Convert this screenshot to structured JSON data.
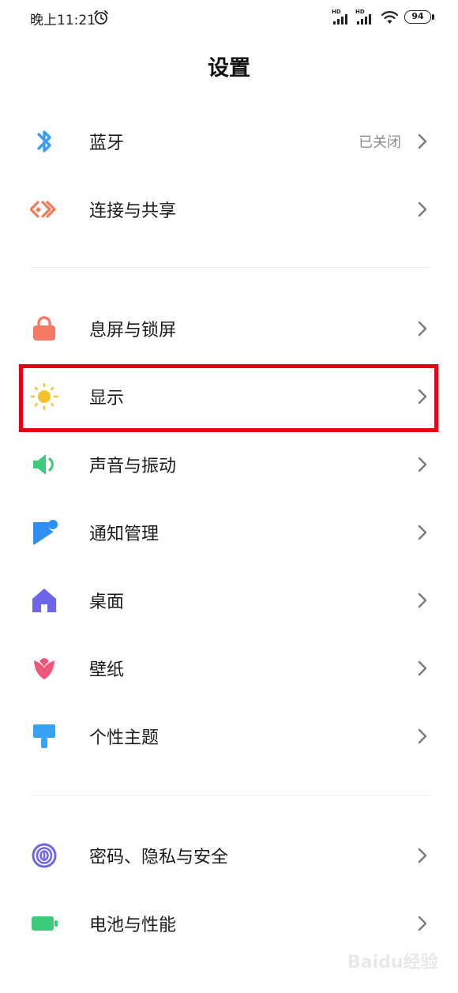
{
  "status_bar": {
    "time": "晚上11:21",
    "battery": "94",
    "signal_label_1": "HD",
    "signal_label_2": "HD"
  },
  "page": {
    "title": "设置"
  },
  "sections": [
    {
      "items": [
        {
          "label": "蓝牙",
          "value": "已关闭",
          "icon": "bluetooth-icon",
          "color": "#3b9cf2"
        },
        {
          "label": "连接与共享",
          "value": "",
          "icon": "connection-share-icon",
          "color": "#f07a5a"
        }
      ]
    },
    {
      "items": [
        {
          "label": "息屏与锁屏",
          "value": "",
          "icon": "lock-icon",
          "color": "#f47a66"
        },
        {
          "label": "显示",
          "value": "",
          "icon": "sun-icon",
          "color": "#f6c02a"
        },
        {
          "label": "声音与振动",
          "value": "",
          "icon": "speaker-icon",
          "color": "#3ccb7a"
        },
        {
          "label": "通知管理",
          "value": "",
          "icon": "notification-icon",
          "color": "#2f8ef0"
        },
        {
          "label": "桌面",
          "value": "",
          "icon": "home-icon",
          "color": "#6e66e8"
        },
        {
          "label": "壁纸",
          "value": "",
          "icon": "tulip-icon",
          "color": "#f0557c"
        },
        {
          "label": "个性主题",
          "value": "",
          "icon": "brush-icon",
          "color": "#3aa2f2"
        }
      ]
    },
    {
      "items": [
        {
          "label": "密码、隐私与安全",
          "value": "",
          "icon": "fingerprint-icon",
          "color": "#6e66e8"
        },
        {
          "label": "电池与性能",
          "value": "",
          "icon": "battery-icon",
          "color": "#3ccb7a"
        }
      ]
    }
  ],
  "highlight": {
    "target": "显示",
    "color": "#e60012"
  },
  "watermark": "Baidu经验"
}
